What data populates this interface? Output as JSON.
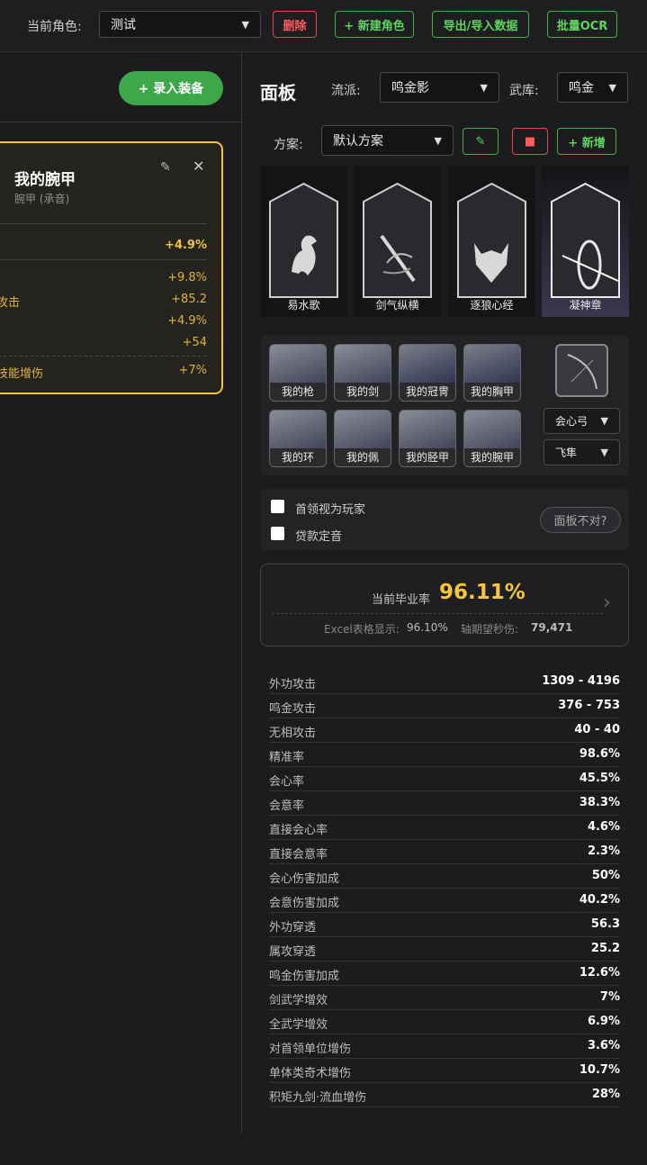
{
  "topbar": {
    "role_label": "当前角色:",
    "role_value": "测试",
    "delete_label": "删除",
    "new_role_label": "+ 新建角色",
    "export_label": "导出/导入数据",
    "ocr_label": "批量OCR"
  },
  "left": {
    "add_equip_label": "+ 录入装备",
    "card": {
      "title": "我的腕甲",
      "subtitle": "腕甲 (承音)",
      "main_value": "+4.9%",
      "rows": [
        {
          "k": "",
          "v": "+9.8%"
        },
        {
          "k": "攻击",
          "v": "+85.2"
        },
        {
          "k": "",
          "v": "+4.9%"
        },
        {
          "k": "",
          "v": "+54"
        },
        {
          "k": "技能增伤",
          "v": "+7%"
        }
      ]
    }
  },
  "panel": {
    "title": "面板",
    "school_label": "流派:",
    "school_value": "鸣金影",
    "armory_label": "武库:",
    "armory_value": "鸣金",
    "plan_label": "方案:",
    "plan_value": "默认方案",
    "add_plan_label": "+ 新增"
  },
  "skills": [
    {
      "name": "易水歌",
      "icon": "horse-icon"
    },
    {
      "name": "剑气纵横",
      "icon": "sword-swirl-icon"
    },
    {
      "name": "逐狼心经",
      "icon": "wolf-icon"
    },
    {
      "name": "凝神章",
      "icon": "bow-arrow-icon"
    }
  ],
  "equipment": [
    {
      "name": "我的枪"
    },
    {
      "name": "我的剑"
    },
    {
      "name": "我的冠冑"
    },
    {
      "name": "我的胸甲"
    },
    {
      "name": "我的环"
    },
    {
      "name": "我的佩"
    },
    {
      "name": "我的胫甲"
    },
    {
      "name": "我的腕甲"
    }
  ],
  "bow_select": "会心弓",
  "bow_select2": "飞隼",
  "options": {
    "boss_player": "首领视为玩家",
    "loan_tone": "贷款定音",
    "panel_wrong": "面板不对?"
  },
  "score": {
    "label": "当前毕业率",
    "value": "96.11%",
    "excel_label": "Excel表格显示:",
    "excel_value": "96.10%",
    "dps_label": "轴期望秒伤:",
    "dps_value": "79,471"
  },
  "stats": [
    {
      "k": "外功攻击",
      "v": "1309 - 4196"
    },
    {
      "k": "鸣金攻击",
      "v": "376 - 753"
    },
    {
      "k": "无相攻击",
      "v": "40 - 40"
    },
    {
      "k": "精准率",
      "v": "98.6%"
    },
    {
      "k": "会心率",
      "v": "45.5%"
    },
    {
      "k": "会意率",
      "v": "38.3%"
    },
    {
      "k": "直接会心率",
      "v": "4.6%"
    },
    {
      "k": "直接会意率",
      "v": "2.3%"
    },
    {
      "k": "会心伤害加成",
      "v": "50%"
    },
    {
      "k": "会意伤害加成",
      "v": "40.2%"
    },
    {
      "k": "外功穿透",
      "v": "56.3"
    },
    {
      "k": "属攻穿透",
      "v": "25.2"
    },
    {
      "k": "鸣金伤害加成",
      "v": "12.6%"
    },
    {
      "k": "剑武学增效",
      "v": "7%"
    },
    {
      "k": "全武学增效",
      "v": "6.9%"
    },
    {
      "k": "对首领单位增伤",
      "v": "3.6%"
    },
    {
      "k": "单体类奇术增伤",
      "v": "10.7%"
    },
    {
      "k": "积矩九剑·流血增伤",
      "v": "28%"
    }
  ],
  "colors": {
    "accent_gold": "#f0c53a",
    "green": "#43b043",
    "red": "#e0484b"
  }
}
